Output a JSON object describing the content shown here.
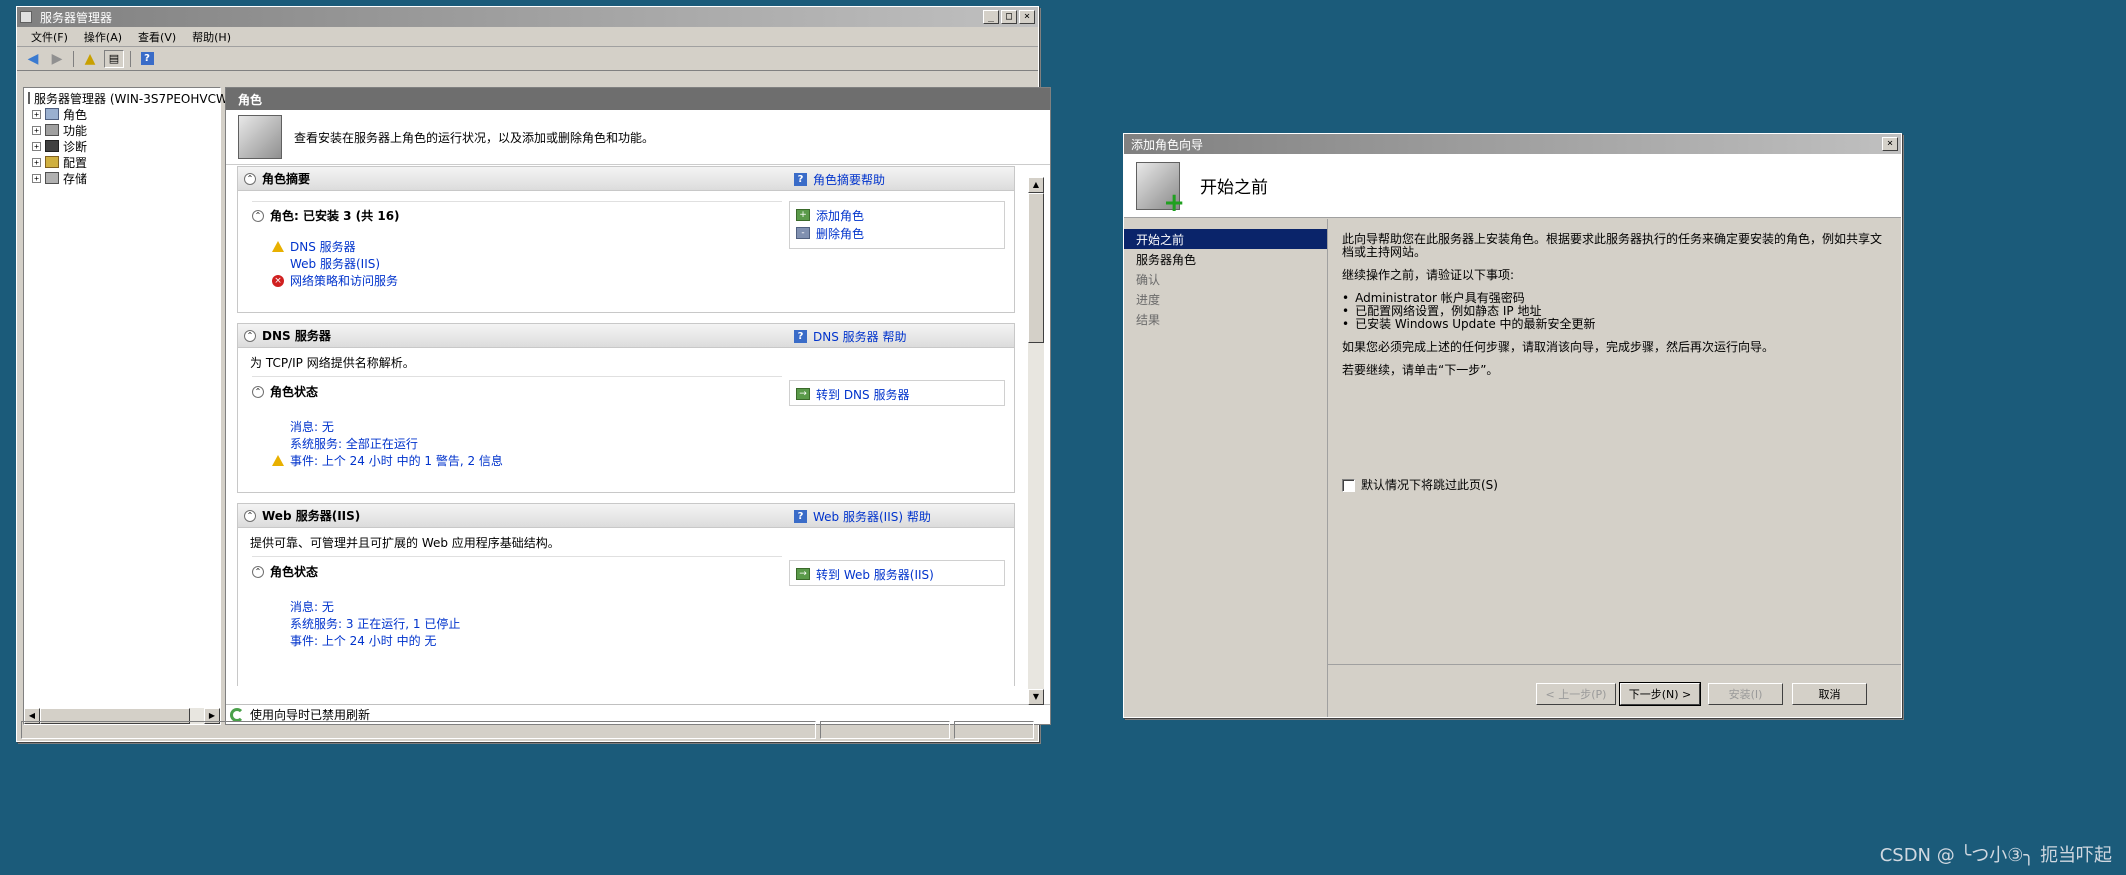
{
  "server_manager": {
    "title": "服务器管理器",
    "menu": [
      "文件(F)",
      "操作(A)",
      "查看(V)",
      "帮助(H)"
    ],
    "tree_root": "服务器管理器 (WIN-3S7PEOHVCW",
    "tree_items": [
      "角色",
      "功能",
      "诊断",
      "配置",
      "存储"
    ],
    "main_header": "角色",
    "intro_text": "查看安装在服务器上角色的运行状况，以及添加或删除角色和功能。",
    "role_summary": {
      "title": "角色摘要",
      "help": "角色摘要帮助",
      "roles_label": "角色: 已安装 3 (共 16)",
      "roles": [
        "DNS 服务器",
        "Web 服务器(IIS)",
        "网络策略和访问服务"
      ],
      "actions": [
        "添加角色",
        "删除角色"
      ]
    },
    "dns": {
      "title": "DNS 服务器",
      "help": "DNS 服务器 帮助",
      "desc": "为 TCP/IP 网络提供名称解析。",
      "status_title": "角色状态",
      "goto": "转到 DNS 服务器",
      "messages": "消息: 无",
      "services": "系统服务: 全部正在运行",
      "events": "事件: 上个 24 小时 中的 1 警告, 2 信息"
    },
    "iis": {
      "title": "Web 服务器(IIS)",
      "help": "Web 服务器(IIS) 帮助",
      "desc": "提供可靠、可管理并且可扩展的 Web 应用程序基础结构。",
      "status_title": "角色状态",
      "goto": "转到 Web 服务器(IIS)",
      "messages": "消息: 无",
      "services": "系统服务: 3 正在运行, 1 已停止",
      "events": "事件: 上个 24 小时 中的 无"
    },
    "refresh_status": "使用向导时已禁用刷新"
  },
  "wizard": {
    "title": "添加角色向导",
    "heading": "开始之前",
    "nav": [
      "开始之前",
      "服务器角色",
      "确认",
      "进度",
      "结果"
    ],
    "para1": "此向导帮助您在此服务器上安装角色。根据要求此服务器执行的任务来确定要安装的角色，例如共享文档或主持网站。",
    "para2": "继续操作之前，请验证以下事项:",
    "bullets": [
      "Administrator 帐户具有强密码",
      "已配置网络设置，例如静态 IP 地址",
      "已安装 Windows Update 中的最新安全更新"
    ],
    "para3": "如果您必须完成上述的任何步骤，请取消该向导，完成步骤，然后再次运行向导。",
    "para4": "若要继续，请单击“下一步”。",
    "skip_checkbox": "默认情况下将跳过此页(S)",
    "buttons": {
      "prev": "< 上一步(P)",
      "next": "下一步(N) >",
      "install": "安装(I)",
      "cancel": "取消"
    }
  },
  "watermark": "CSDN @ ╰つ小③╮ 扼当吓起"
}
